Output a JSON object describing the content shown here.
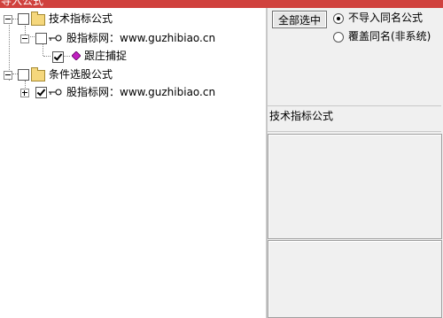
{
  "window": {
    "title": "导入公式"
  },
  "tree": {
    "root1": {
      "label": "技术指标公式"
    },
    "site1": {
      "label": "股指标网：www.guzhibiao.cn"
    },
    "formula": {
      "label": "跟庄捕捉"
    },
    "root2": {
      "label": "条件选股公式"
    },
    "site2": {
      "label": "股指标网：www.guzhibiao.cn"
    }
  },
  "options": {
    "select_all_label": "全部选中",
    "radio_skip_label": "不导入同名公式",
    "radio_overwrite_label": "覆盖同名(非系统)"
  },
  "detail": {
    "category_label": "技术指标公式"
  }
}
